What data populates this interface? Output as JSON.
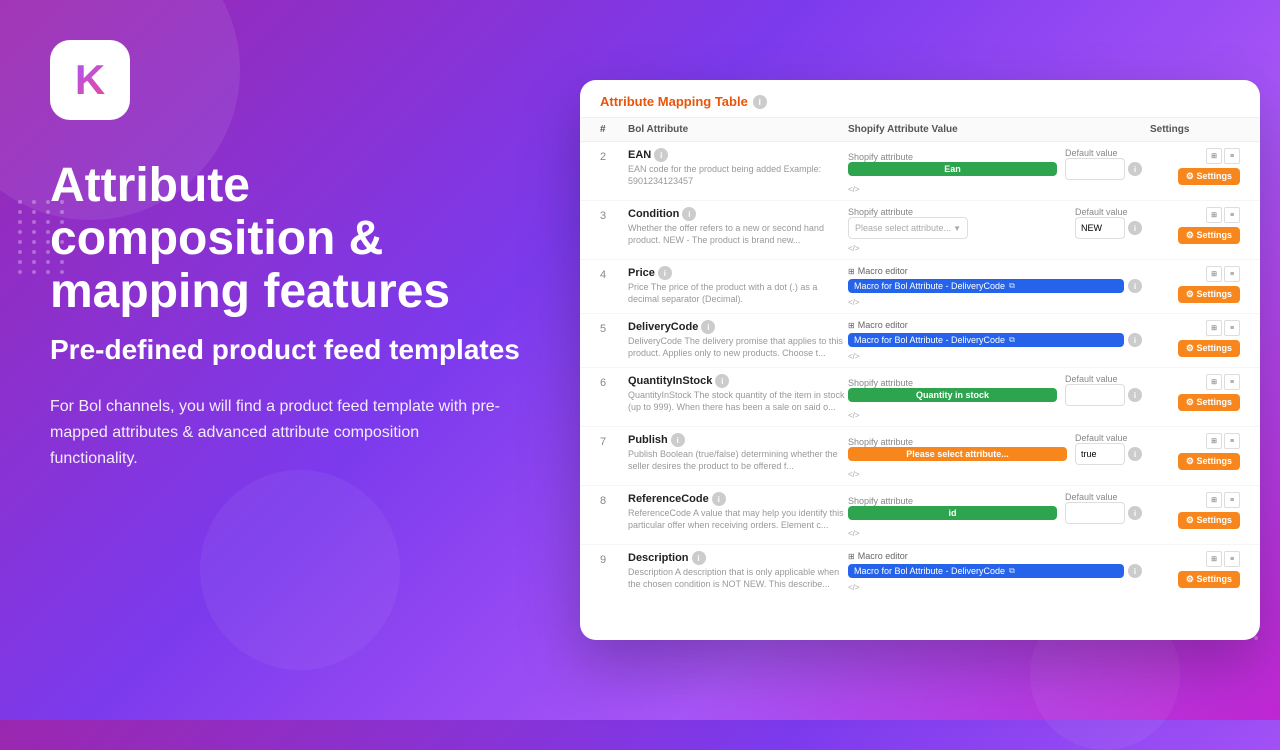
{
  "background": {
    "gradient_start": "#9b27af",
    "gradient_end": "#c026d3"
  },
  "logo": {
    "letter": "K"
  },
  "hero": {
    "heading_line1": "Attribute",
    "heading_line2": "composition &",
    "heading_line3": "mapping features",
    "subheading": "Pre-defined product feed templates",
    "description": "For Bol channels, you will find a product feed template with pre-mapped attributes & advanced attribute composition functionality."
  },
  "card": {
    "title": "Attribute Mapping Table",
    "columns": {
      "hash": "#",
      "bol_attribute": "Bol Attribute",
      "shopify_value": "Shopify Attribute Value",
      "settings": "Settings"
    },
    "rows": [
      {
        "num": "2",
        "name": "EAN",
        "desc": "EAN code for the product being added Example: 5901234123457",
        "type": "shopify",
        "shopify_label": "Shopify attribute",
        "shopify_value": "Ean",
        "shopify_color": "green",
        "default_label": "Default value",
        "default_value": ""
      },
      {
        "num": "3",
        "name": "Condition",
        "desc": "Whether the offer refers to a new or second hand product. NEW - The product is brand new...",
        "type": "select",
        "shopify_label": "Shopify attribute",
        "shopify_value": "Please select attribute...",
        "shopify_color": "select",
        "default_label": "Default value",
        "default_value": "NEW"
      },
      {
        "num": "4",
        "name": "Price",
        "desc": "Price of the product with a dot (.) as a decimal separator (Decimal).",
        "type": "macro",
        "shopify_label": "Macro editor",
        "macro_text": "Macro for Bol Attribute - DeliveryCode",
        "default_label": "",
        "default_value": ""
      },
      {
        "num": "5",
        "name": "DeliveryCode",
        "desc": "DeliveryCode\nThe delivery promise that applies to this product. Applies only to new products. Choose t...",
        "type": "macro",
        "shopify_label": "Macro editor",
        "macro_text": "Macro for Bol Attribute - DeliveryCode",
        "default_label": "",
        "default_value": ""
      },
      {
        "num": "6",
        "name": "QuantityInStock",
        "desc": "QuantityInStock\nThe stock quantity of the item in stock (up to 999). When there has been a sale on said o...",
        "type": "shopify",
        "shopify_label": "Shopify attribute",
        "shopify_value": "Quantity in stock",
        "shopify_color": "green",
        "default_label": "Default value",
        "default_value": ""
      },
      {
        "num": "7",
        "name": "Publish",
        "desc": "Publish\nBoolean (true/false) determining whether the seller desires the product to be offered f...",
        "type": "shopify",
        "shopify_label": "Shopify attribute",
        "shopify_value": "Please select attribute...",
        "shopify_color": "orange",
        "default_label": "Default value",
        "default_value": "true"
      },
      {
        "num": "8",
        "name": "ReferenceCode",
        "desc": "ReferenceCode\nA value that may help you identify this particular offer when receiving orders. Element c...",
        "type": "shopify",
        "shopify_label": "Shopify attribute",
        "shopify_value": "id",
        "shopify_color": "green",
        "default_label": "Default value",
        "default_value": ""
      },
      {
        "num": "9",
        "name": "Description",
        "desc": "Description\nA description that is only applicable when the chosen condition is NOT NEW. This describe...",
        "type": "macro",
        "shopify_label": "Macro editor",
        "macro_text": "Macro for Bol Attribute - DeliveryCode",
        "default_label": "",
        "default_value": ""
      }
    ],
    "settings_button_label": "⚙ Settings"
  }
}
